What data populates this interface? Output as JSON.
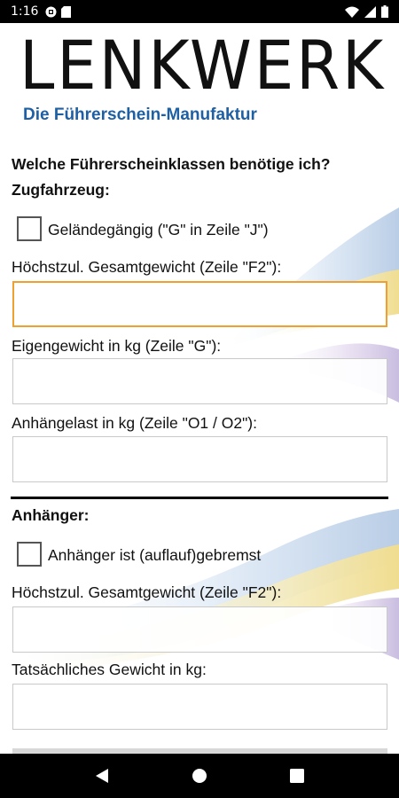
{
  "status_bar": {
    "time": "1:16",
    "icons": [
      "circle-notification-icon",
      "sd-card-icon",
      "wifi-icon",
      "signal-icon",
      "battery-icon"
    ]
  },
  "header": {
    "logo": "LENKWERK",
    "tagline": "Die Führerschein-Manufaktur"
  },
  "colors": {
    "tagline_blue": "#1f5fa3",
    "focus_orange": "#f0a030"
  },
  "form": {
    "question": "Welche Führerscheinklassen benötige ich?",
    "zugfahrzeug": {
      "heading": "Zugfahrzeug:",
      "gelaendegaengig_label": "Geländegängig (\"G\" in Zeile \"J\")",
      "gesamtgewicht_label": "Höchstzul. Gesamtgewicht (Zeile \"F2\"):",
      "gesamtgewicht_value": "",
      "eigengewicht_label": "Eigengewicht in kg (Zeile \"G\"):",
      "eigengewicht_value": "",
      "anhaengelast_label": "Anhängelast in kg  (Zeile \"O1 / O2\"):",
      "anhaengelast_value": ""
    },
    "anhaenger": {
      "heading": "Anhänger:",
      "gebremst_label": "Anhänger ist (auflauf)gebremst",
      "gesamtgewicht_label": "Höchstzul. Gesamtgewicht (Zeile \"F2\"):",
      "gesamtgewicht_value": "",
      "tatsaechlich_label": "Tatsächliches Gewicht in kg:",
      "tatsaechlich_value": ""
    }
  },
  "nav_bar": {
    "icons": [
      "back-icon",
      "home-icon",
      "recents-icon"
    ]
  }
}
